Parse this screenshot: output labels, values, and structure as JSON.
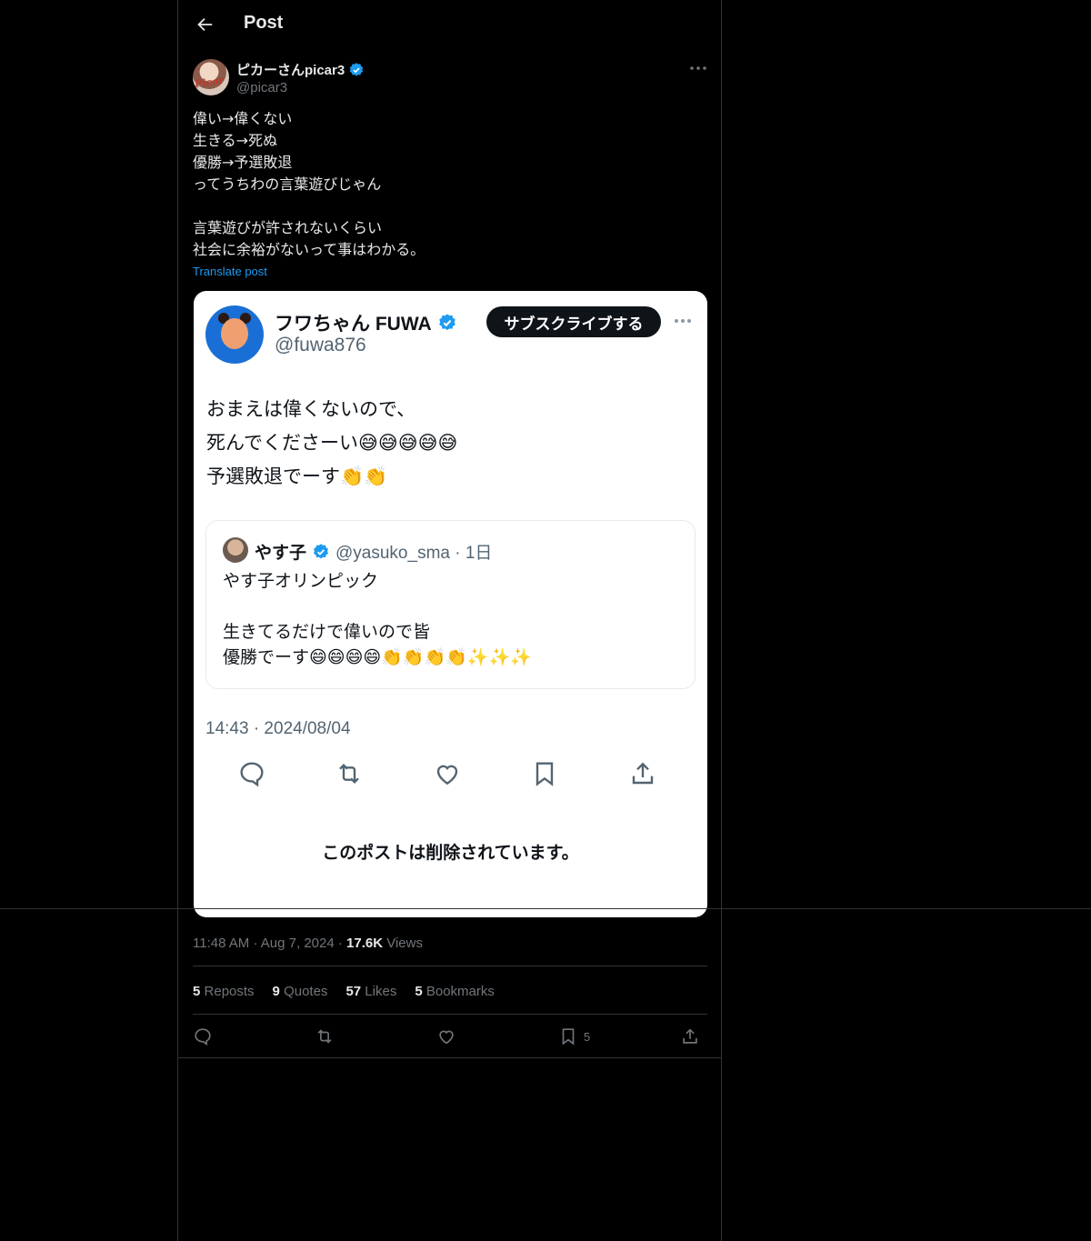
{
  "header": {
    "title": "Post"
  },
  "author": {
    "name": "ピカーさんpicar3",
    "handle": "@picar3",
    "avatar_text": "Picar"
  },
  "tweet": {
    "lines": [
      "偉い→偉くない",
      "生きる→死ぬ",
      "優勝→予選敗退",
      "ってうちわの言葉遊びじゃん",
      "",
      "言葉遊びが許されないくらい",
      "社会に余裕がないって事はわかる。"
    ],
    "translate_label": "Translate post"
  },
  "card": {
    "name": "フワちゃん FUWA",
    "handle": "@fuwa876",
    "subscribe_label": "サブスクライブする",
    "lines": [
      "おまえは偉くないので、",
      "死んでくださーい😅😅😅😅😅",
      "予選敗退でーす👏👏"
    ],
    "quote": {
      "name": "やす子",
      "meta": "@yasuko_sma · 1日",
      "lines": [
        "やす子オリンピック",
        "",
        "生きてるだけで偉いので皆",
        "優勝でーす😄😄😄😄👏👏👏👏✨✨✨"
      ]
    },
    "timestamp": "14:43 · 2024/08/04",
    "deleted_notice": "このポストは削除されています。"
  },
  "meta": {
    "time": "11:48 AM",
    "date": "Aug 7, 2024",
    "views_count": "17.6K",
    "views_label": "Views"
  },
  "stats": [
    {
      "count": "5",
      "label": "Reposts"
    },
    {
      "count": "9",
      "label": "Quotes"
    },
    {
      "count": "57",
      "label": "Likes"
    },
    {
      "count": "5",
      "label": "Bookmarks"
    }
  ],
  "actions": {
    "bookmark_count": "5"
  },
  "colors": {
    "accent": "#1d9bf0",
    "verified": "#1d9bf0",
    "background": "#000000",
    "border": "#2f3336"
  }
}
